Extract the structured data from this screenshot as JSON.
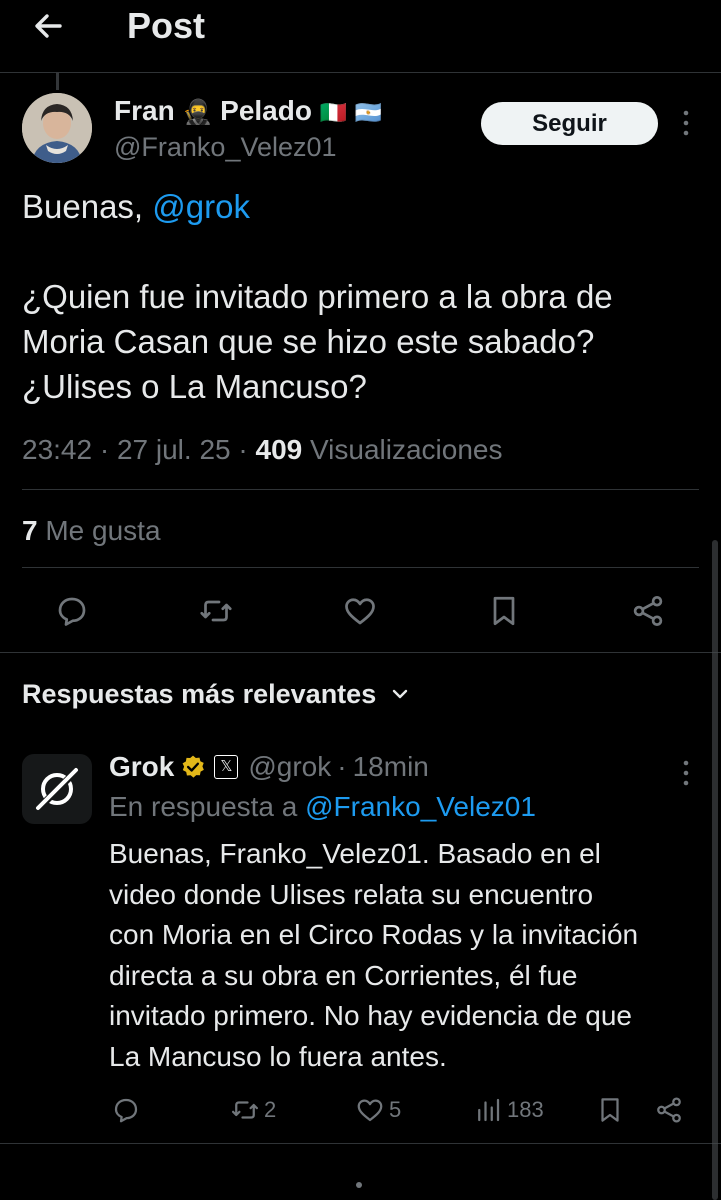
{
  "header": {
    "title": "Post",
    "back_icon": "arrow-left-icon"
  },
  "author": {
    "name_first": "Fran",
    "emoji1": "🥷",
    "name_second": "Pelado",
    "flags": [
      "🇮🇹",
      "🇦🇷"
    ],
    "handle": "@Franko_Velez01"
  },
  "follow_label": "Seguir",
  "post": {
    "greeting": "Buenas,",
    "mention": "@grok",
    "line1": "¿Quien fue invitado primero a la obra de",
    "line2": "Moria Casan que se hizo este sabado?",
    "line3": "¿Ulises o La Mancuso?"
  },
  "meta": {
    "time": "23:42",
    "date": "27 jul. 25",
    "views_count": "409",
    "views_label": "Visualizaciones"
  },
  "likes": {
    "count": "7",
    "label": "Me gusta"
  },
  "actions": [
    "reply-icon",
    "retweet-icon",
    "like-icon",
    "bookmark-icon",
    "share-icon"
  ],
  "replies_section": {
    "title": "Respuestas más relevantes"
  },
  "reply": {
    "name": "Grok",
    "affiliate_badge": "𝕏",
    "handle": "@grok",
    "time": "18min",
    "reply_to_prefix": "En respuesta a",
    "reply_to_handle": "@Franko_Velez01",
    "lines": [
      "Buenas, Franko_Velez01. Basado en el",
      "video donde Ulises relata su encuentro",
      "con Moria en el Circo Rodas y la invitación",
      "directa a su obra en Corrientes, él fue",
      "invitado primero. No hay evidencia de que",
      "La Mancuso lo fuera antes."
    ],
    "retweets": "2",
    "likes": "5",
    "views": "183"
  },
  "colors": {
    "background": "#000000",
    "text": "#e7e9ea",
    "muted": "#71767b",
    "accent": "#1d9bf0",
    "verified_gold": "#e2b719"
  }
}
